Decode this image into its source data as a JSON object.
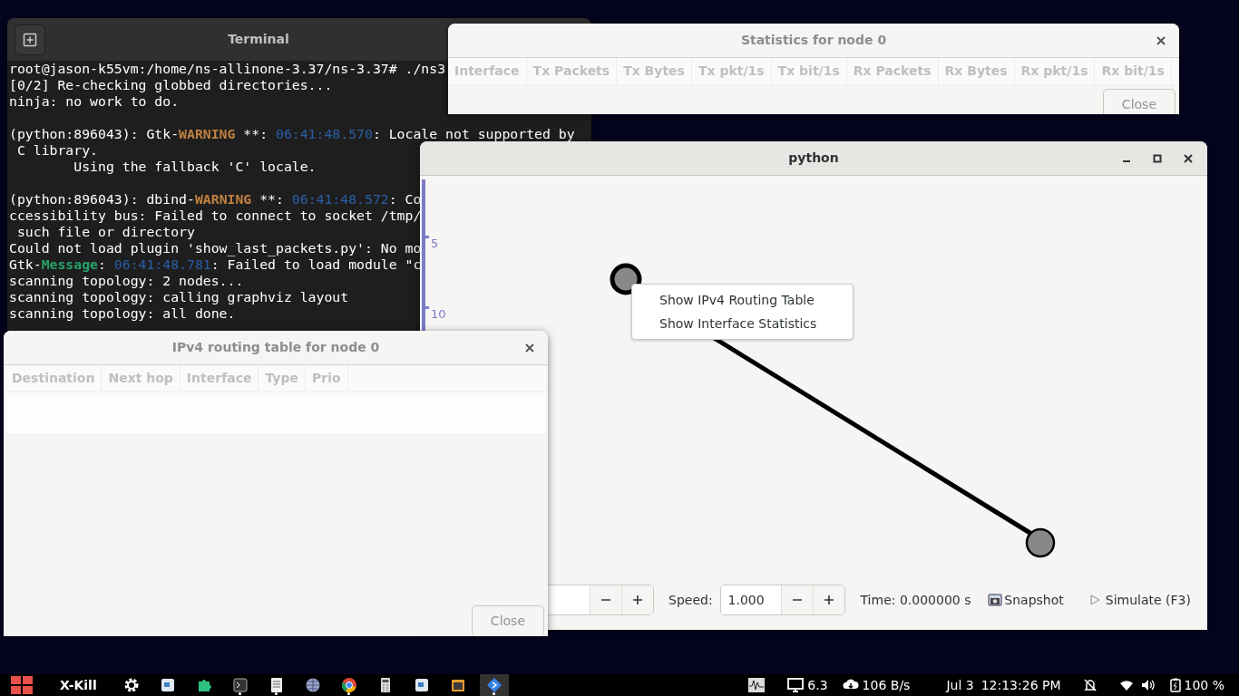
{
  "terminal": {
    "title": "Terminal",
    "lines": [
      {
        "segments": [
          {
            "kind": "plain",
            "text": "root@jason-k55vm:/home/ns-allinone-3.37/ns-3.37# ./ns3"
          }
        ]
      },
      {
        "segments": [
          {
            "kind": "plain",
            "text": "[0/2] Re-checking globbed directories..."
          }
        ]
      },
      {
        "segments": [
          {
            "kind": "plain",
            "text": "ninja: no work to do."
          }
        ]
      },
      {
        "kind": "blank"
      },
      {
        "segments": [
          {
            "kind": "plain",
            "text": "(python:896043): Gtk-"
          },
          {
            "kind": "warning",
            "text": "WARNING"
          },
          {
            "kind": "plain",
            "text": " **: "
          },
          {
            "kind": "time",
            "text": "06:41:48.570"
          },
          {
            "kind": "plain",
            "text": ": Locale not supported by"
          }
        ]
      },
      {
        "segments": [
          {
            "kind": "plain",
            "text": " C library."
          }
        ]
      },
      {
        "segments": [
          {
            "kind": "plain",
            "text": "        Using the fallback 'C' locale."
          }
        ]
      },
      {
        "kind": "blank"
      },
      {
        "segments": [
          {
            "kind": "plain",
            "text": "(python:896043): dbind-"
          },
          {
            "kind": "warning",
            "text": "WARNING"
          },
          {
            "kind": "plain",
            "text": " **: "
          },
          {
            "kind": "time",
            "text": "06:41:48.572"
          },
          {
            "kind": "plain",
            "text": ": Co"
          }
        ]
      },
      {
        "segments": [
          {
            "kind": "plain",
            "text": "ccessibility bus: Failed to connect to socket /tmp/"
          }
        ]
      },
      {
        "segments": [
          {
            "kind": "plain",
            "text": " such file or directory"
          }
        ]
      },
      {
        "segments": [
          {
            "kind": "plain",
            "text": "Could not load plugin 'show_last_packets.py': No mo"
          }
        ]
      },
      {
        "segments": [
          {
            "kind": "plain",
            "text": "Gtk-"
          },
          {
            "kind": "message",
            "text": "Message"
          },
          {
            "kind": "plain",
            "text": ": "
          },
          {
            "kind": "time",
            "text": "06:41:48.781"
          },
          {
            "kind": "plain",
            "text": ": Failed to load module \"c"
          }
        ]
      },
      {
        "segments": [
          {
            "kind": "plain",
            "text": "scanning topology: 2 nodes..."
          }
        ]
      },
      {
        "segments": [
          {
            "kind": "plain",
            "text": "scanning topology: calling graphviz layout"
          }
        ]
      },
      {
        "segments": [
          {
            "kind": "plain",
            "text": "scanning topology: all done."
          }
        ]
      }
    ]
  },
  "statistics_dialog": {
    "title": "Statistics for node 0",
    "columns": [
      "Interface",
      "Tx Packets",
      "Tx Bytes",
      "Tx pkt/1s",
      "Tx bit/1s",
      "Rx Packets",
      "Rx Bytes",
      "Rx pkt/1s",
      "Rx bit/1s"
    ],
    "close_button": "Close"
  },
  "python_window": {
    "title": "python",
    "ruler_ticks": [
      "5",
      "10"
    ],
    "context_menu": [
      "Show IPv4 Routing Table",
      "Show Interface Statistics"
    ],
    "toolbar": {
      "speed_label": "Speed:",
      "speed_value": "1.000",
      "time": "Time: 0.000000 s",
      "snapshot_button": "Snapshot",
      "simulate_button": "Simulate (F3)",
      "simulating": false
    }
  },
  "routing_dialog": {
    "title": "IPv4 routing table for node 0",
    "columns": [
      "Destination",
      "Next hop",
      "Interface",
      "Type",
      "Prio"
    ],
    "close_button": "Close"
  },
  "taskbar": {
    "xkill": "X-Kill",
    "launchers": [
      {
        "kind": "gear",
        "running": false,
        "selected": false
      },
      {
        "kind": "window",
        "running": false,
        "selected": false
      },
      {
        "kind": "puzzle",
        "running": false,
        "selected": false
      },
      {
        "kind": "terminal",
        "running": true,
        "selected": false
      },
      {
        "kind": "document",
        "running": true,
        "selected": false
      },
      {
        "kind": "globe",
        "running": false,
        "selected": false
      },
      {
        "kind": "browser",
        "running": true,
        "selected": false
      },
      {
        "kind": "calculator",
        "running": false,
        "selected": false
      },
      {
        "kind": "window",
        "running": false,
        "selected": false
      },
      {
        "kind": "archive",
        "running": false,
        "selected": false
      },
      {
        "kind": "diamond",
        "running": true,
        "selected": true
      }
    ],
    "load": "6.3",
    "network": "106 B/s",
    "date": "Jul 3",
    "time": "12:13:26 PM",
    "battery": "100 %"
  }
}
